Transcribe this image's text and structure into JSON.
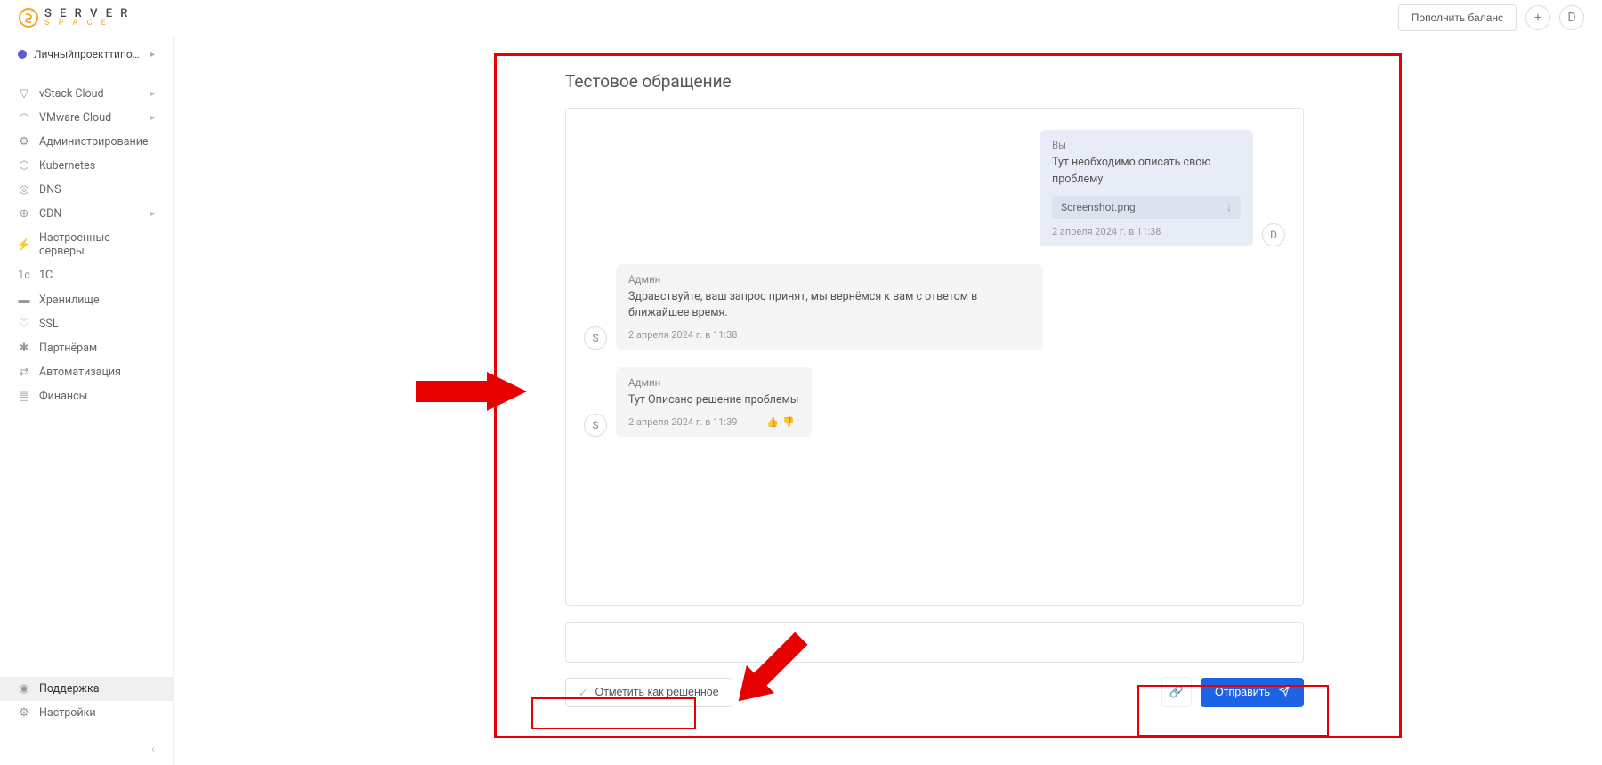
{
  "brand": {
    "name_top": "S E R V E R",
    "name_bottom": "S P A C E"
  },
  "header": {
    "topup_label": "Пополнить баланс",
    "plus_icon": "+",
    "user_initial": "D"
  },
  "project": {
    "name": "Личныйпроекттипот…",
    "caret": "▸"
  },
  "sidebar": {
    "items": [
      {
        "label": "vStack Cloud",
        "icon": "▽",
        "caret": true
      },
      {
        "label": "VMware Cloud",
        "icon": "◠",
        "caret": true
      },
      {
        "label": "Администрирование",
        "icon": "⚙"
      },
      {
        "label": "Kubernetes",
        "icon": "⬡"
      },
      {
        "label": "DNS",
        "icon": "◎"
      },
      {
        "label": "CDN",
        "icon": "⊕",
        "caret": true
      },
      {
        "label": "Настроенные серверы",
        "icon": "⚡"
      },
      {
        "label": "1C",
        "icon": "1c"
      },
      {
        "label": "Хранилище",
        "icon": "▬"
      },
      {
        "label": "SSL",
        "icon": "♡"
      },
      {
        "label": "Партнёрам",
        "icon": "✱"
      },
      {
        "label": "Автоматизация",
        "icon": "⇄"
      },
      {
        "label": "Финансы",
        "icon": "▤"
      }
    ],
    "bottom": [
      {
        "label": "Поддержка",
        "icon": "◉",
        "active": true
      },
      {
        "label": "Настройки",
        "icon": "⚙"
      }
    ],
    "collapse": "‹"
  },
  "ticket": {
    "title": "Тестовое обращение",
    "messages": {
      "user1": {
        "sender": "Вы",
        "text": "Тут необходимо описать свою проблему",
        "attachment": "Screenshot.png",
        "timestamp": "2 апреля 2024 г. в 11:38",
        "avatar": "D"
      },
      "admin1": {
        "sender": "Админ",
        "text": "Здравствуйте, ваш запрос принят, мы вернёмся к вам с ответом в ближайшее время.",
        "timestamp": "2 апреля 2024 г. в 11:38",
        "avatar": "S"
      },
      "admin2": {
        "sender": "Админ",
        "text": "Тут   Описано решение проблемы",
        "timestamp": "2 апреля 2024 г. в 11:39",
        "avatar": "S"
      }
    }
  },
  "actions": {
    "resolve_label": "Отметить как решенное",
    "send_label": "Отправить"
  }
}
